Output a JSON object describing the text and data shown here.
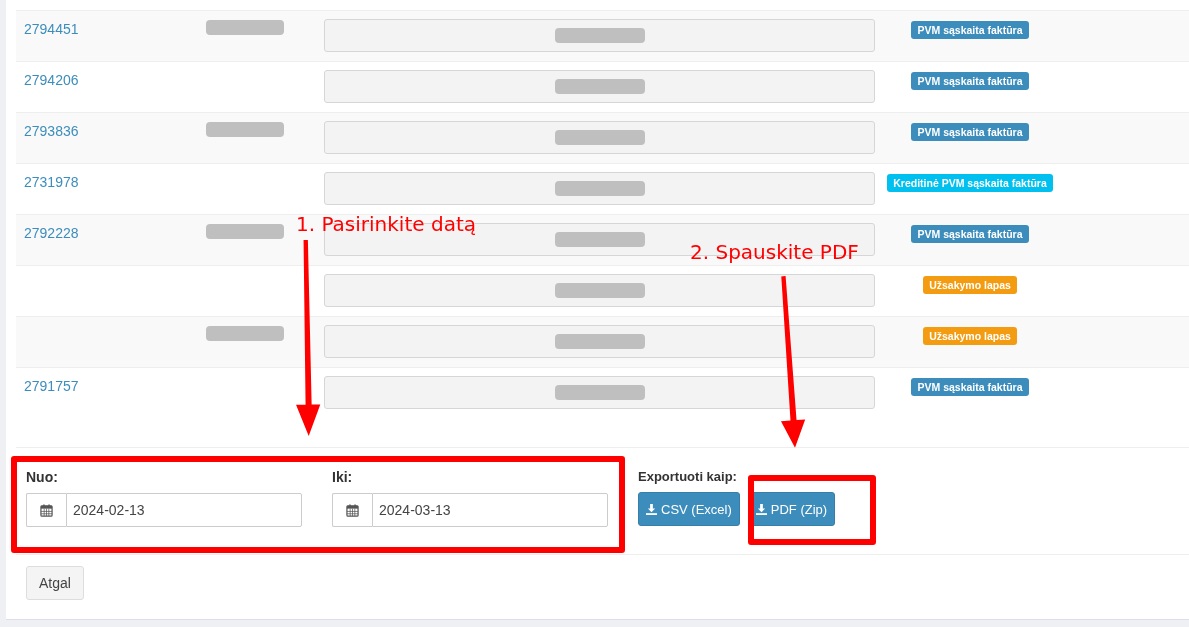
{
  "rows": [
    {
      "id": "2794451",
      "name_redacted": true,
      "badge": {
        "kind": "invoice",
        "text": "PVM sąskaita faktūra"
      }
    },
    {
      "id": "2794206",
      "name_redacted": false,
      "badge": {
        "kind": "invoice",
        "text": "PVM sąskaita faktūra"
      }
    },
    {
      "id": "2793836",
      "name_redacted": true,
      "badge": {
        "kind": "invoice",
        "text": "PVM sąskaita faktūra"
      }
    },
    {
      "id": "2731978",
      "name_redacted": false,
      "badge": {
        "kind": "credit",
        "text": "Kreditinė PVM sąskaita faktūra"
      }
    },
    {
      "id": "2792228",
      "name_redacted": true,
      "badge": {
        "kind": "invoice",
        "text": "PVM sąskaita faktūra"
      }
    },
    {
      "name_redacted": false,
      "badge": {
        "kind": "order",
        "text": "Užsakymo lapas"
      }
    },
    {
      "name_redacted": true,
      "badge": {
        "kind": "order",
        "text": "Užsakymo lapas"
      }
    },
    {
      "id": "2791757",
      "name_redacted": false,
      "badge": {
        "kind": "invoice",
        "text": "PVM sąskaita faktūra"
      }
    }
  ],
  "filters": [
    {
      "label": "Nuo:",
      "value": "2024-02-13"
    },
    {
      "label": "Iki:",
      "value": "2024-03-13"
    }
  ],
  "export": {
    "label": "Exportuoti kaip:",
    "buttons": [
      "CSV (Excel)",
      "PDF (Zip)"
    ]
  },
  "back_button": "Atgal",
  "annotations": [
    {
      "text": "1. Pasirinkite datą"
    },
    {
      "text": "2. Spauskite PDF"
    }
  ]
}
